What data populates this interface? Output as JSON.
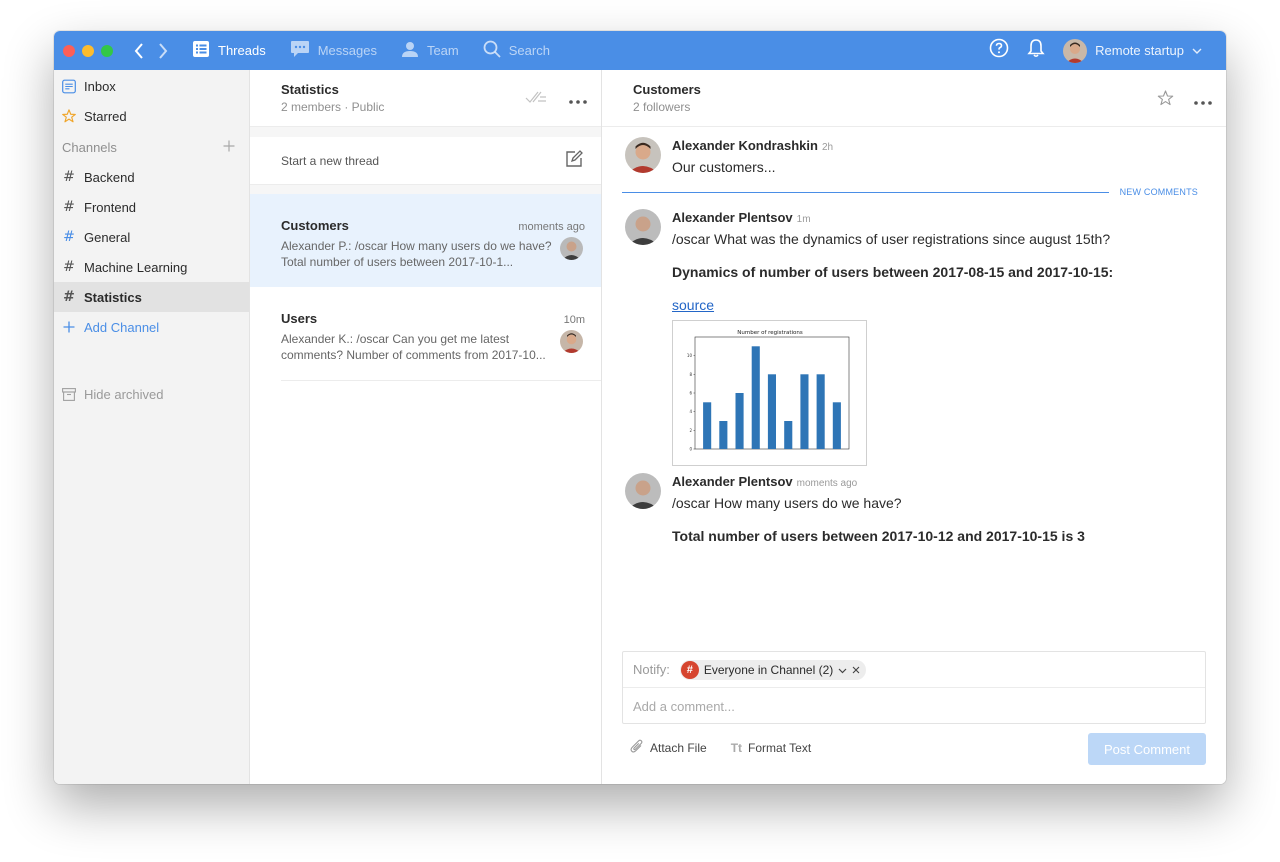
{
  "topbar": {
    "tabs": [
      {
        "label": "Threads",
        "icon": "threads-icon",
        "active": true
      },
      {
        "label": "Messages",
        "icon": "messages-icon",
        "active": false
      },
      {
        "label": "Team",
        "icon": "team-icon",
        "active": false
      },
      {
        "label": "Search",
        "icon": "search-icon",
        "active": false
      }
    ],
    "user_label": "Remote startup",
    "accent_color": "#4a8ee6"
  },
  "sidebar": {
    "inbox": "Inbox",
    "starred": "Starred",
    "channels_header": "Channels",
    "channels": [
      "Backend",
      "Frontend",
      "General",
      "Machine Learning",
      "Statistics"
    ],
    "selected_channel": "Statistics",
    "add_channel": "Add Channel",
    "hide_archived": "Hide archived"
  },
  "threads": {
    "channel_title": "Statistics",
    "channel_sub": "2 members · Public",
    "new_thread": "Start a new thread",
    "items": [
      {
        "name": "Customers",
        "time": "moments ago",
        "snippet": "Alexander P.: /oscar How many users do we have?  Total number of users between 2017-10-1..."
      },
      {
        "name": "Users",
        "time": "10m",
        "snippet": "Alexander K.: /oscar Can you get me latest comments?  Number of comments from 2017-10..."
      }
    ]
  },
  "detail": {
    "title": "Customers",
    "followers": "2 followers",
    "new_comments": "NEW COMMENTS",
    "messages": [
      {
        "author": "Alexander Kondrashkin",
        "time": "2h",
        "text": "Our customers..."
      },
      {
        "author": "Alexander Plentsov",
        "time": "1m",
        "text": "/oscar What was the dynamics of user registrations since august 15th?",
        "result": "Dynamics of number of users between 2017-08-15 and 2017-10-15:",
        "link": "source"
      },
      {
        "author": "Alexander Plentsov",
        "time": "moments ago",
        "text": "/oscar How many users do we have?",
        "result": "Total number of users between 2017-10-12 and 2017-10-15 is 3"
      }
    ],
    "composer": {
      "notify_label": "Notify:",
      "chip": "Everyone in Channel (2)",
      "placeholder": "Add a comment...",
      "attach": "Attach File",
      "format": "Format Text",
      "format_glyph": "Tt",
      "post": "Post Comment"
    }
  },
  "chart_data": {
    "type": "bar",
    "title": "Number of registrations",
    "values": [
      5,
      3,
      6,
      11,
      8,
      3,
      8,
      8,
      5
    ],
    "ylim": [
      0,
      12
    ],
    "yticks": [
      0,
      2,
      4,
      6,
      8,
      10
    ],
    "color": "#2e75b6"
  }
}
